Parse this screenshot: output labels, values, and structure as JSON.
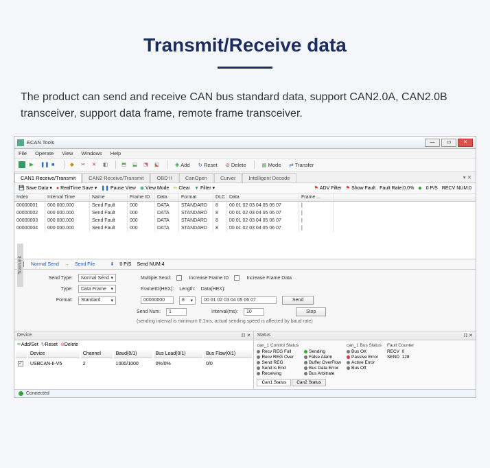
{
  "page": {
    "title": "Transmit/Receive data",
    "description": "The product can send and receive CAN bus standard data, support CAN2.0A, CAN2.0B transceiver, support data frame, remote frame transceiver."
  },
  "window": {
    "title": "ECAN Tools"
  },
  "menu": [
    "File",
    "Operate",
    "View",
    "Windows",
    "Help"
  ],
  "toolbar2": {
    "add": "Add",
    "reset": "Reset",
    "delete": "Delete",
    "mode": "Mode",
    "transfer": "Transfer"
  },
  "tabs": [
    "CAN1 Receive/Transmit",
    "CAN2 Receive/Transmit",
    "OBD II",
    "CanOpen",
    "Curver",
    "Intelligent Decode"
  ],
  "subbar": {
    "saveData": "Save Data",
    "realtime": "RealTime Save",
    "pause": "Pause View",
    "viewMode": "View Mode",
    "clear": "Clear",
    "filter": "Filter",
    "advFilter": "ADV Filter",
    "showFault": "Show Fault",
    "faultRate": "Fault Rate:0.0%",
    "ps": "0 P/S",
    "recv": "RECV NUM:0"
  },
  "gridHeaders": [
    "Index",
    "Interval Time",
    "Name",
    "Frame ID",
    "Data",
    "Format",
    "DLC",
    "Data",
    "Frame ..."
  ],
  "gridRows": [
    {
      "idx": "00000001",
      "time": "000 000.000",
      "name": "Send Fault",
      "fid": "000",
      "data": "DATA",
      "fmt": "STANDARD",
      "dlc": "8",
      "bytes": "00 01 02 03 04 05 06 07",
      "frame": "|"
    },
    {
      "idx": "00000002",
      "time": "000 000.000",
      "name": "Send Fault",
      "fid": "000",
      "data": "DATA",
      "fmt": "STANDARD",
      "dlc": "8",
      "bytes": "00 01 02 03 04 05 06 07",
      "frame": "|"
    },
    {
      "idx": "00000003",
      "time": "000 000.000",
      "name": "Send Fault",
      "fid": "000",
      "data": "DATA",
      "fmt": "STANDARD",
      "dlc": "8",
      "bytes": "00 01 02 03 04 05 06 07",
      "frame": "|"
    },
    {
      "idx": "00000004",
      "time": "000 000.000",
      "name": "Send Fault",
      "fid": "000",
      "data": "DATA",
      "fmt": "STANDARD",
      "dlc": "8",
      "bytes": "00 01 02 03 04 05 06 07",
      "frame": "|"
    }
  ],
  "sendbar": {
    "normal": "Normal Send",
    "sendFile": "Send File",
    "ps": "0 P/S",
    "sendNum": "Send NUM:4"
  },
  "transmit": {
    "sideLabel": "Transmit",
    "sendTypeL": "Send Type:",
    "sendType": "Normal Send",
    "typeL": "Type:",
    "type": "Data Frame",
    "formatL": "Format:",
    "format": "Standard",
    "multiSend": "Multiple Send:",
    "incFrameId": "Increase Frame ID",
    "incFrameData": "Increase Frame Data",
    "frameIdL": "FrameID(HEX):",
    "frameId": "00000000",
    "lengthL": "Length:",
    "length": "8",
    "dataL": "Data(HEX):",
    "data": "00 01 02 03 04 05 06 07",
    "sendNumL": "Send Num:",
    "sendNum": "1",
    "intervalL": "Interval(ms):",
    "interval": "10",
    "send": "Send",
    "stop": "Stop",
    "note": "(sending interval is minimum 0.1ms, actual sending speed is affected by baud rate)"
  },
  "device": {
    "title": "Device",
    "add": "Add/Set",
    "reset": "Reset",
    "delete": "Delete",
    "headers": [
      "",
      "Device",
      "Channel",
      "Baud(0/1)",
      "Bus Load(0/1)",
      "Bus Flow(0/1)"
    ],
    "row": {
      "dev": "USBCAN-II-V5",
      "ch": "2",
      "baud": "1000/1000",
      "load": "0%/0%",
      "flow": "0/0"
    }
  },
  "status": {
    "title": "Status",
    "col1": {
      "hdr": "can_1 Control Status",
      "items": [
        "Recv REG Full",
        "Recv REG Over",
        "Send REG",
        "Send is End",
        "Receiving"
      ]
    },
    "col2": {
      "items": [
        "Sending",
        "False Alarm",
        "Buffer OverFlow",
        "Bus Data Error",
        "Bus Arbitrate"
      ]
    },
    "col3": {
      "hdr": "can_1 Bus Status",
      "items": [
        "Bus OK",
        "Passive Error",
        "Active Error",
        "Bus Off"
      ]
    },
    "col4": {
      "hdr": "Fault Counter",
      "recvL": "RECV",
      "recv": "0",
      "sendL": "SEND",
      "send": "128"
    },
    "tabs": [
      "Can1 Status",
      "Can2 Status"
    ]
  },
  "statusbar": {
    "connected": "Connected"
  }
}
